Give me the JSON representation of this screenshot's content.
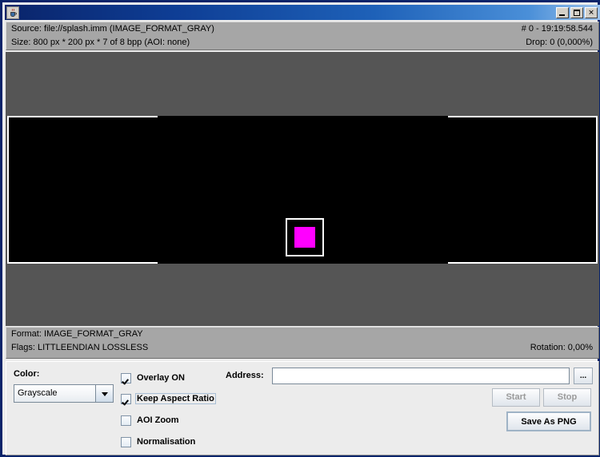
{
  "window": {
    "title": "",
    "icon": "java-coffee-cup-icon",
    "buttons": {
      "minimize": "_",
      "maximize": "□",
      "close": "✕"
    }
  },
  "header": {
    "source_line": "Source: file://splash.imm (IMAGE_FORMAT_GRAY)",
    "frame_line": "# 0 - 19:19:58.544",
    "size_line": "Size: 800 px * 200 px * 7 of 8 bpp   (AOI: none)",
    "drop_line": "Drop: 0 (0,000%)"
  },
  "footer": {
    "format_line": "Format: IMAGE_FORMAT_GRAY",
    "flags_line": "Flags: LITTLEENDIAN LOSSLESS",
    "rotation_line": "Rotation: 0,00%"
  },
  "viewport": {
    "background_color": "#555555",
    "image_color": "#000000",
    "overlay_color": "#ffffff",
    "aoi_color": "#ff00ff"
  },
  "controls": {
    "color_label": "Color:",
    "color_value": "Grayscale",
    "color_options": [
      "Grayscale"
    ],
    "checkboxes": [
      {
        "label": "Overlay ON",
        "checked": true,
        "focused": false
      },
      {
        "label": "Keep Aspect Ratio",
        "checked": true,
        "focused": true
      },
      {
        "label": "AOI Zoom",
        "checked": false,
        "focused": false
      },
      {
        "label": "Normalisation",
        "checked": false,
        "focused": false
      }
    ],
    "address_label": "Address:",
    "address_value": "",
    "address_placeholder": "",
    "browse_button": "...",
    "start_button": "Start",
    "stop_button": "Stop",
    "save_button": "Save As PNG"
  }
}
